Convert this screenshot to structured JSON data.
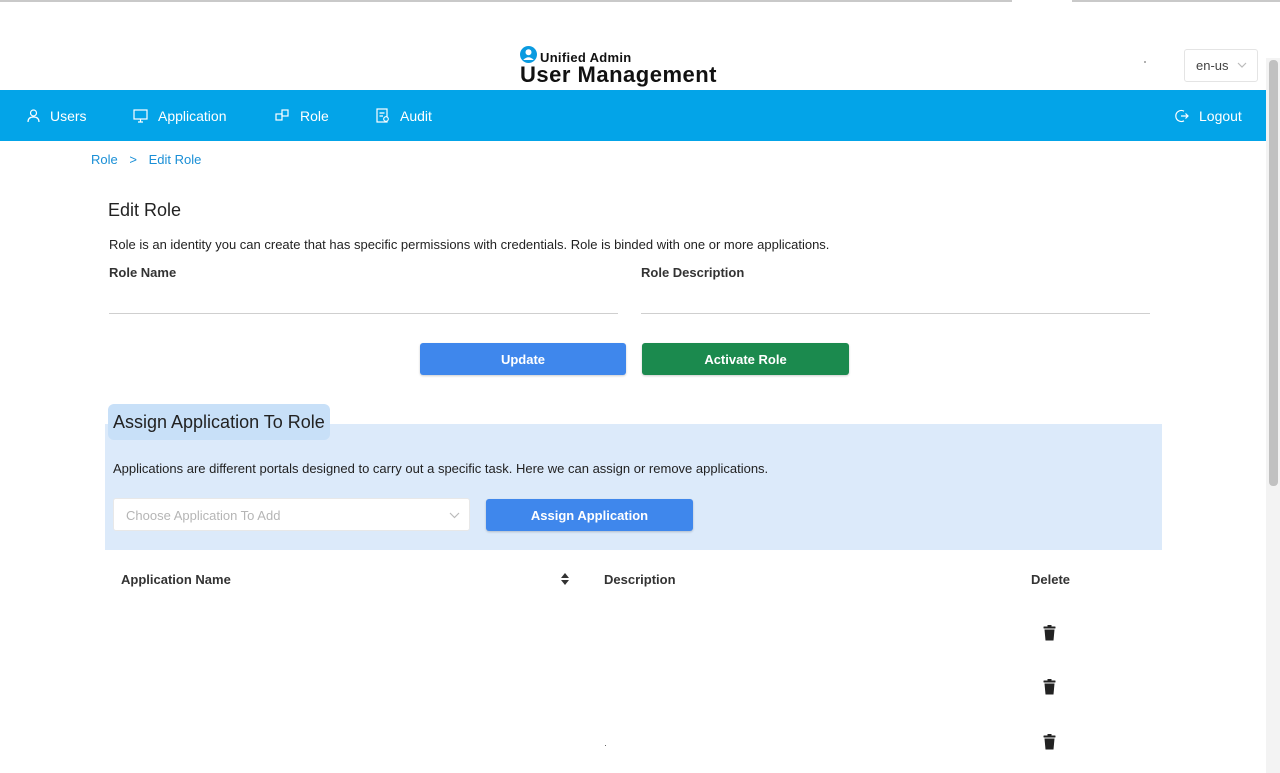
{
  "app": {
    "logo_small": "Unified Admin",
    "logo_big": "User Management",
    "language": "en-us"
  },
  "nav": {
    "items": [
      {
        "label": "Users",
        "icon": "user-icon"
      },
      {
        "label": "Application",
        "icon": "monitor-icon"
      },
      {
        "label": "Role",
        "icon": "role-icon"
      },
      {
        "label": "Audit",
        "icon": "audit-icon"
      }
    ],
    "logout": {
      "label": "Logout",
      "icon": "logout-icon"
    }
  },
  "breadcrumb": {
    "root": "Role",
    "separator": ">",
    "current": "Edit Role"
  },
  "edit_role": {
    "title": "Edit Role",
    "description": "Role is an identity you can create that has specific permissions with credentials. Role is binded with one or more applications.",
    "role_name_label": "Role Name",
    "role_name_value": "",
    "role_description_label": "Role Description",
    "role_description_value": "",
    "update_button": "Update",
    "activate_button": "Activate Role"
  },
  "assign": {
    "title": "Assign Application To Role",
    "description": "Applications are different portals designed to carry out a specific task. Here we can assign or remove applications.",
    "select_placeholder": "Choose Application To Add",
    "assign_button": "Assign Application"
  },
  "table": {
    "columns": [
      "Application Name",
      "Description",
      "Delete"
    ],
    "rows": [
      {
        "name": "",
        "description": ""
      },
      {
        "name": "",
        "description": ""
      },
      {
        "name": "",
        "description": ""
      }
    ]
  },
  "colors": {
    "nav_bg": "#03a4e8",
    "primary_button": "#3f87ec",
    "activate_button": "#1b8a4e",
    "assign_panel_bg": "#dceafa",
    "link": "#1a8fd6"
  }
}
